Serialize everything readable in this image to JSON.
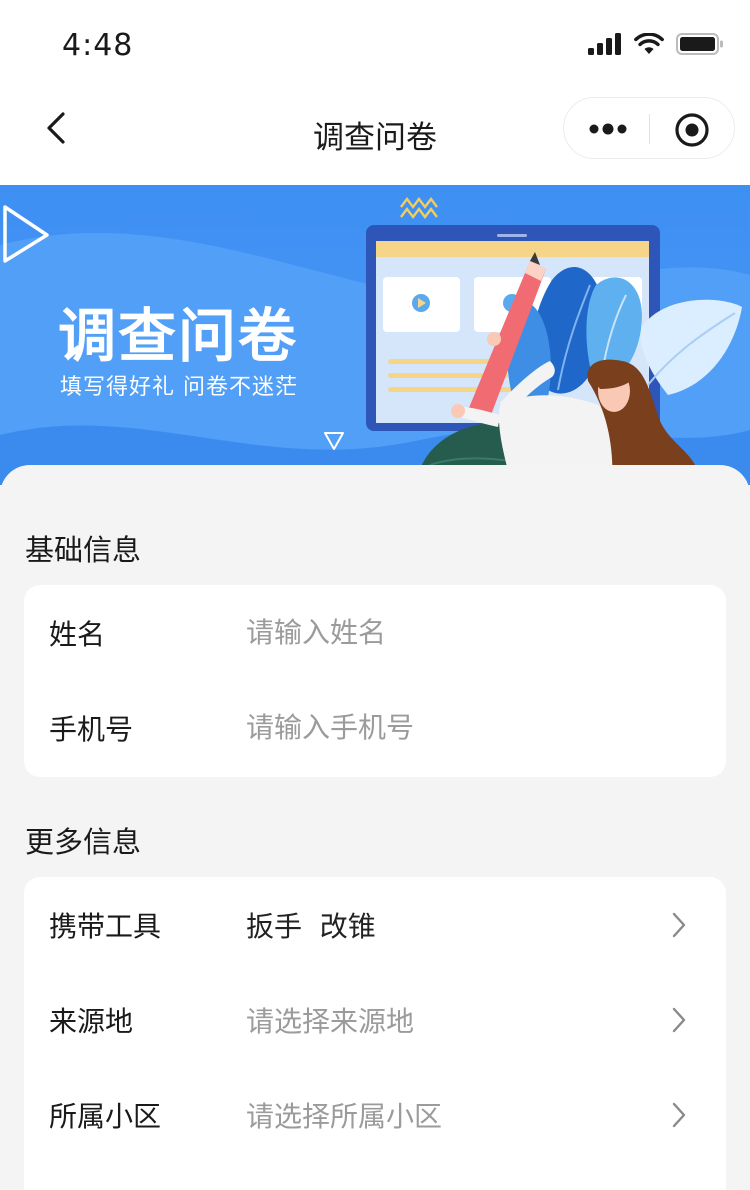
{
  "status_bar": {
    "time": "4:48"
  },
  "nav": {
    "title": "调查问卷"
  },
  "banner": {
    "title": "调查问卷",
    "subtitle": "填写得好礼 问卷不迷茫"
  },
  "basic_section": {
    "title": "基础信息",
    "fields": [
      {
        "label": "姓名",
        "value": "",
        "placeholder": "请输入姓名"
      },
      {
        "label": "手机号",
        "value": "",
        "placeholder": "请输入手机号"
      }
    ]
  },
  "more_section": {
    "title": "更多信息",
    "fields": [
      {
        "label": "携带工具",
        "value": "扳手  改锥"
      },
      {
        "label": "来源地",
        "placeholder": "请选择来源地"
      },
      {
        "label": "所属小区",
        "placeholder": "请选择所属小区"
      }
    ]
  }
}
